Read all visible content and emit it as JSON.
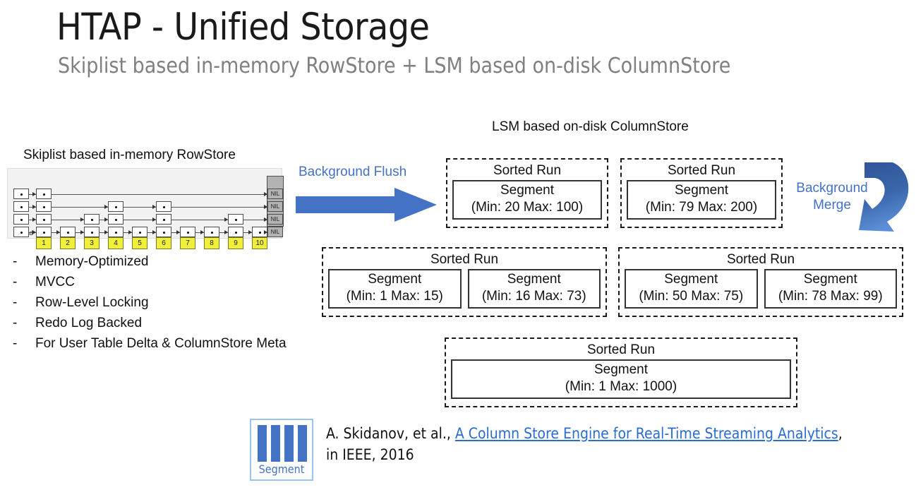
{
  "slide": {
    "title": "HTAP - Unified Storage",
    "subtitle": "Skiplist based in-memory RowStore + LSM based on-disk ColumnStore"
  },
  "rowstore": {
    "heading": "Skiplist based in-memory RowStore",
    "head_label": "Head",
    "nil_label": "NIL",
    "nil_count": 4,
    "levels": 4,
    "keys": [
      "1",
      "2",
      "3",
      "4",
      "5",
      "6",
      "7",
      "8",
      "9",
      "10"
    ],
    "node_heights": [
      4,
      1,
      2,
      3,
      1,
      3,
      1,
      1,
      2,
      1
    ],
    "bullets": [
      {
        "marker": "-",
        "label": "Memory-Optimized"
      },
      {
        "marker": "-",
        "label": "MVCC"
      },
      {
        "marker": "-",
        "label": "Row-Level Locking"
      },
      {
        "marker": "-",
        "label": "Redo Log Backed"
      },
      {
        "marker": "-",
        "label": "For User Table Delta & ColumnStore Meta"
      }
    ]
  },
  "flush": {
    "label": "Background Flush",
    "color": "#4472c4"
  },
  "merge": {
    "label_line1": "Background",
    "label_line2": "Merge",
    "color": "#4472c4"
  },
  "columnstore": {
    "heading": "LSM based on-disk ColumnStore",
    "runs": [
      {
        "title": "Sorted Run",
        "segments": [
          {
            "name": "Segment",
            "range": "(Min: 20 Max: 100)",
            "min": 20,
            "max": 100
          }
        ]
      },
      {
        "title": "Sorted Run",
        "segments": [
          {
            "name": "Segment",
            "range": "(Min: 79 Max: 200)",
            "min": 79,
            "max": 200
          }
        ]
      },
      {
        "title": "Sorted Run",
        "segments": [
          {
            "name": "Segment",
            "range": "(Min: 1 Max: 15)",
            "min": 1,
            "max": 15
          },
          {
            "name": "Segment",
            "range": "(Min: 16 Max: 73)",
            "min": 16,
            "max": 73
          }
        ]
      },
      {
        "title": "Sorted Run",
        "segments": [
          {
            "name": "Segment",
            "range": "(Min: 50 Max: 75)",
            "min": 50,
            "max": 75
          },
          {
            "name": "Segment",
            "range": "(Min: 78 Max: 99)",
            "min": 78,
            "max": 99
          }
        ]
      },
      {
        "title": "Sorted Run",
        "segments": [
          {
            "name": "Segment",
            "range": "(Min: 1 Max: 1000)",
            "min": 1,
            "max": 1000
          }
        ]
      }
    ]
  },
  "footer": {
    "legend_label": "Segment",
    "legend_bar_count": 4,
    "citation_prefix": "A. Skidanov, et al., ",
    "citation_link": "A Column Store Engine for Real-Time Streaming Analytics",
    "citation_suffix": ",",
    "citation_line2": "in IEEE, 2016"
  }
}
